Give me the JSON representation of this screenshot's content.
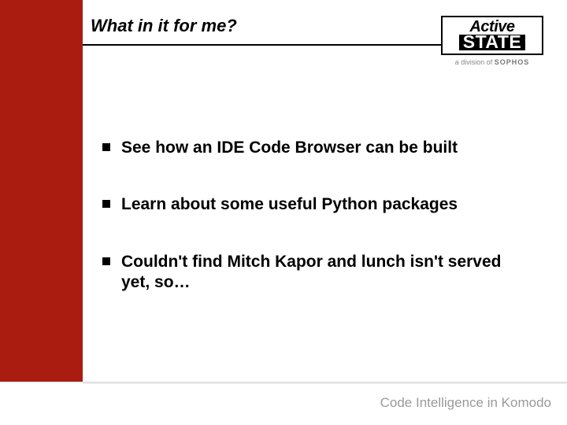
{
  "title": "What in it for me?",
  "logo": {
    "line1": "Active",
    "line2": "STATE",
    "subline_prefix": "a division of ",
    "subline_brand": "SOPHOS"
  },
  "bullets": [
    "See how an IDE Code Browser can be built",
    "Learn about some useful Python packages",
    "Couldn't find Mitch Kapor and lunch isn't served yet, so…"
  ],
  "footer": "Code Intelligence in Komodo"
}
